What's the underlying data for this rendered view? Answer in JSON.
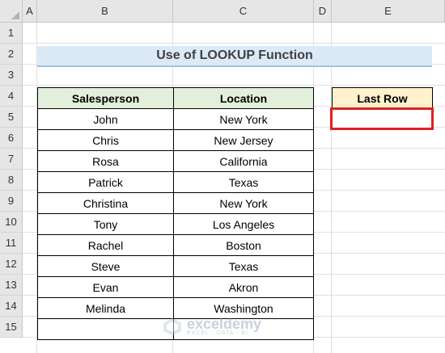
{
  "columns": [
    "A",
    "B",
    "C",
    "D",
    "E"
  ],
  "rows": [
    "1",
    "2",
    "3",
    "4",
    "5",
    "6",
    "7",
    "8",
    "9",
    "10",
    "11",
    "12",
    "13",
    "14",
    "15"
  ],
  "title": "Use of LOOKUP Function",
  "table": {
    "headers": [
      "Salesperson",
      "Location"
    ],
    "rows": [
      [
        "John",
        "New York"
      ],
      [
        "Chris",
        "New Jersey"
      ],
      [
        "Rosa",
        "California"
      ],
      [
        "Patrick",
        "Texas"
      ],
      [
        "Christina",
        "New York"
      ],
      [
        "Tony",
        "Los Angeles"
      ],
      [
        "Rachel",
        "Boston"
      ],
      [
        "Steve",
        "Texas"
      ],
      [
        "Evan",
        "Akron"
      ],
      [
        "Melinda",
        "Washington"
      ],
      [
        "",
        ""
      ]
    ]
  },
  "last_row": {
    "header": "Last Row",
    "value": ""
  },
  "watermark": {
    "name": "exceldemy",
    "tagline": "EXCEL · DATA · BI"
  },
  "colors": {
    "table_header": "#e2efda",
    "title_fill": "#dce9f6",
    "last_row_header": "#fff2cc",
    "highlight_border": "#e02020"
  }
}
